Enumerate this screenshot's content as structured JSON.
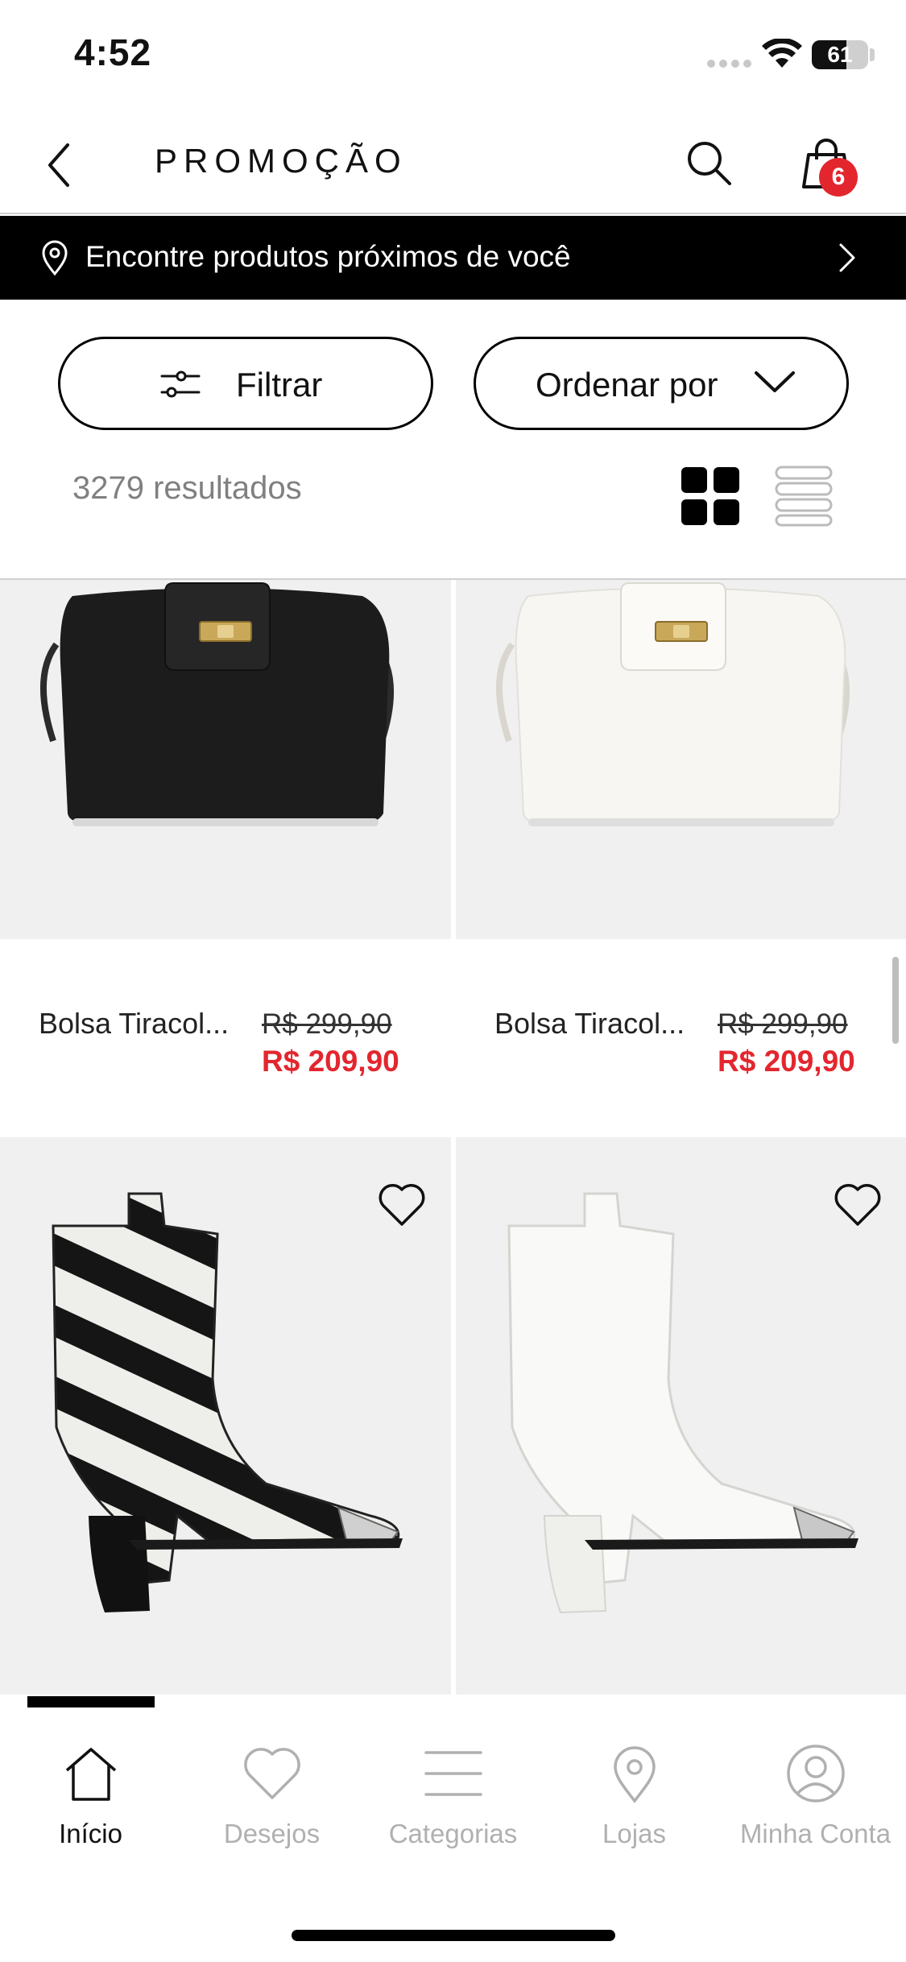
{
  "status_bar": {
    "time": "4:52",
    "battery_percent": 61,
    "battery_label": "61"
  },
  "header": {
    "title": "PROMOÇÃO",
    "cart_count": "6"
  },
  "store_banner": {
    "text": "Encontre produtos próximos de você"
  },
  "toolbar": {
    "filter_label": "Filtrar",
    "sort_label": "Ordenar por",
    "results_count": "3279 resultados",
    "view_mode": "grid"
  },
  "products": [
    {
      "name": "Bolsa Tiracol...",
      "price_old": "R$ 299,90",
      "price_new": "R$ 209,90",
      "image": "black-crossbody-bag"
    },
    {
      "name": "Bolsa Tiracol...",
      "price_old": "R$ 299,90",
      "price_new": "R$ 209,90",
      "image": "white-crossbody-bag"
    },
    {
      "image": "zebra-print-western-boot",
      "icon": "heart-icon"
    },
    {
      "image": "white-western-boot",
      "icon": "heart-icon"
    }
  ],
  "tab_bar": {
    "items": [
      {
        "label": "Início",
        "icon": "home-icon",
        "active": true
      },
      {
        "label": "Desejos",
        "icon": "heart-icon",
        "active": false
      },
      {
        "label": "Categorias",
        "icon": "menu-icon",
        "active": false
      },
      {
        "label": "Lojas",
        "icon": "map-pin-icon",
        "active": false
      },
      {
        "label": "Minha Conta",
        "icon": "user-icon",
        "active": false
      }
    ]
  },
  "colors": {
    "accent_red": "#e3262e",
    "black": "#000000",
    "muted_gray": "#808080",
    "image_bg": "#f0f0f0"
  }
}
